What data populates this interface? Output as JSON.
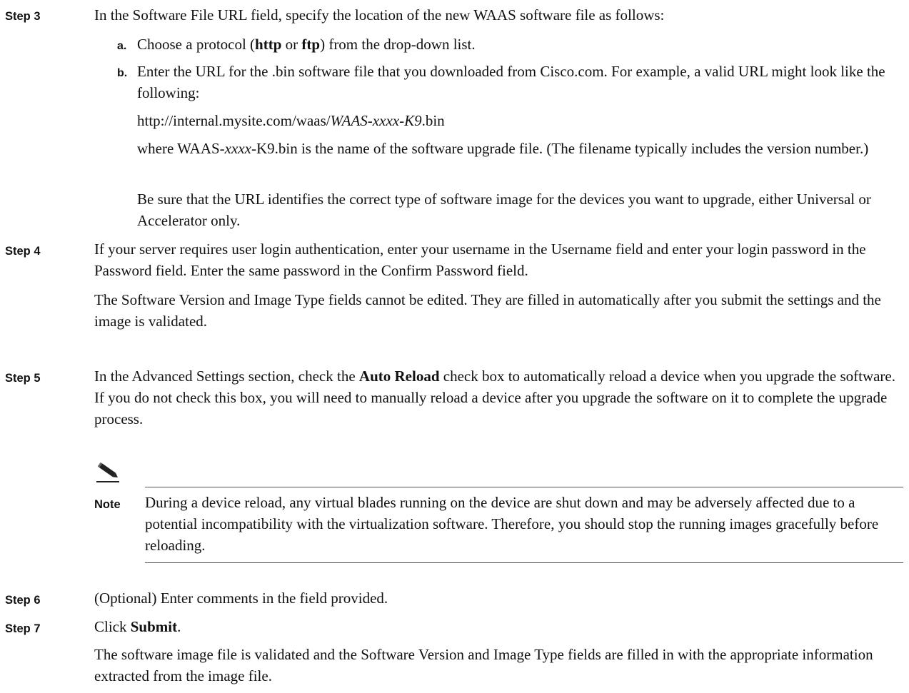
{
  "step3": {
    "label": "Step 3",
    "text": "In the Software File URL field, specify the location of the new WAAS software file as follows:",
    "a_label": "a.",
    "a_pre": "Choose a protocol (",
    "a_http": "http",
    "a_or": " or ",
    "a_ftp": "ftp",
    "a_post": ") from the drop-down list.",
    "b_label": "b.",
    "b_text": "Enter the URL for the .bin software file that you downloaded from Cisco.com. For example, a valid URL might look like the following:",
    "url_pre": "http://internal.mysite.com/waas/",
    "url_italic": "WAAS-xxxx-K9",
    "url_post": ".bin",
    "where_pre": "where WAAS-",
    "where_italic": "xxxx",
    "where_post": "-K9.bin is the name of the software upgrade file. (The filename typically includes the version number.)",
    "be_sure": "Be sure that the URL identifies the correct type of software image for the devices you want to upgrade, either Universal or Accelerator only."
  },
  "step4": {
    "label": "Step 4",
    "text": "If your server requires user login authentication, enter your username in the Username field and enter your login password in the Password field. Enter the same password in the Confirm Password field.",
    "text2": "The Software Version and Image Type fields cannot be edited. They are filled in automatically after you submit the settings and the image is validated."
  },
  "step5": {
    "label": "Step 5",
    "pre": "In the Advanced Settings section, check the ",
    "bold": "Auto Reload",
    "post": " check box to automatically reload a device when you upgrade the software. If you do not check this box, you will need to manually reload a device after you upgrade the software on it to complete the upgrade process."
  },
  "note": {
    "icon": "pencil-note-icon",
    "label": "Note",
    "text": "During a device reload, any virtual blades running on the device are shut down and may be adversely affected due to a potential incompatibility with the virtualization software. Therefore, you should stop the running images gracefully before reloading."
  },
  "step6": {
    "label": "Step 6",
    "text": "(Optional) Enter comments in the field provided."
  },
  "step7": {
    "label": "Step 7",
    "pre": "Click ",
    "bold": "Submit",
    "post": ".",
    "text2": "The software image file is validated and the Software Version and Image Type fields are filled in with the appropriate information extracted from the image file."
  }
}
